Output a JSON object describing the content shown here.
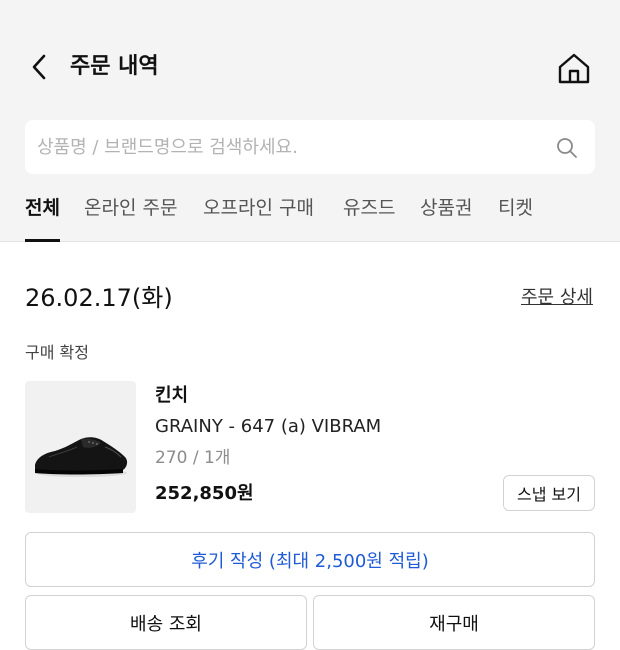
{
  "header": {
    "title": "주문 내역",
    "back_icon": "chevron-left-icon",
    "home_icon": "home-icon"
  },
  "search": {
    "placeholder": "상품명 / 브랜드명으로 검색하세요.",
    "value": "",
    "icon": "search-icon"
  },
  "tabs": [
    {
      "label": "전체",
      "active": true
    },
    {
      "label": "온라인 주문",
      "active": false
    },
    {
      "label": "오프라인 구매",
      "active": false
    },
    {
      "label": "유즈드",
      "active": false
    },
    {
      "label": "상품권",
      "active": false
    },
    {
      "label": "티켓",
      "active": false
    }
  ],
  "order": {
    "date": "26.02.17(화)",
    "detail_link": "주문 상세",
    "status": "구매 확정",
    "product": {
      "brand": "킨치",
      "name": "GRAINY - 647 (a) VIBRAM",
      "option": "270 / 1개",
      "price": "252,850원",
      "snap_button": "스냅 보기",
      "image": "black-derby-shoe"
    },
    "actions": {
      "review": "후기 작성 (최대 2,500원 적립)",
      "delivery": "배송 조회",
      "rebuy": "재구매"
    }
  },
  "colors": {
    "background_top": "#f4f4f4",
    "accent_blue": "#1f5bd6",
    "text_primary": "#111111",
    "text_muted": "#8c8c8c"
  }
}
